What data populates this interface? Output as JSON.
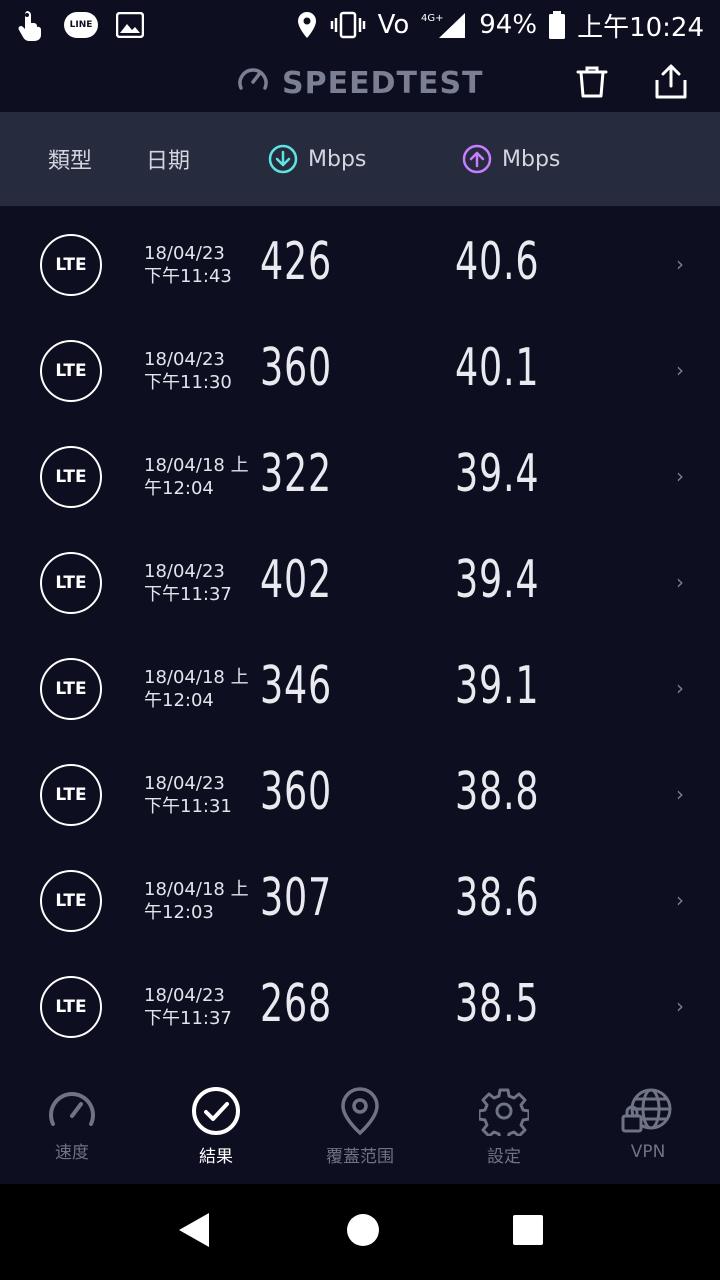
{
  "status_bar": {
    "line_app": "LINE",
    "network": "Vo",
    "network_gen": "4G+",
    "battery": "94%",
    "time": "上午10:24"
  },
  "header": {
    "brand": "SPEEDTEST"
  },
  "columns": {
    "type": "類型",
    "date": "日期",
    "download": "Mbps",
    "upload": "Mbps"
  },
  "results": [
    {
      "type": "LTE",
      "date_line1": "18/04/23",
      "date_line2": "下午11:43",
      "download": "426",
      "upload": "40.6"
    },
    {
      "type": "LTE",
      "date_line1": "18/04/23",
      "date_line2": "下午11:30",
      "download": "360",
      "upload": "40.1"
    },
    {
      "type": "LTE",
      "date_line1": "18/04/18 上",
      "date_line2": "午12:04",
      "download": "322",
      "upload": "39.4"
    },
    {
      "type": "LTE",
      "date_line1": "18/04/23",
      "date_line2": "下午11:37",
      "download": "402",
      "upload": "39.4"
    },
    {
      "type": "LTE",
      "date_line1": "18/04/18 上",
      "date_line2": "午12:04",
      "download": "346",
      "upload": "39.1"
    },
    {
      "type": "LTE",
      "date_line1": "18/04/23",
      "date_line2": "下午11:31",
      "download": "360",
      "upload": "38.8"
    },
    {
      "type": "LTE",
      "date_line1": "18/04/18 上",
      "date_line2": "午12:03",
      "download": "307",
      "upload": "38.6"
    },
    {
      "type": "LTE",
      "date_line1": "18/04/23",
      "date_line2": "下午11:37",
      "download": "268",
      "upload": "38.5"
    }
  ],
  "bottom_nav": [
    {
      "label": "速度",
      "icon": "speedometer-icon",
      "active": false
    },
    {
      "label": "結果",
      "icon": "check-circle-icon",
      "active": true
    },
    {
      "label": "覆蓋范围",
      "icon": "map-pin-icon",
      "active": false
    },
    {
      "label": "設定",
      "icon": "gear-icon",
      "active": false
    },
    {
      "label": "VPN",
      "icon": "vpn-globe-lock-icon",
      "active": false
    }
  ],
  "colors": {
    "background": "#0d0e1f",
    "header_band": "#262b3e",
    "download_accent": "#5fe3e0",
    "upload_accent": "#c77dff",
    "muted": "#6e7386"
  }
}
